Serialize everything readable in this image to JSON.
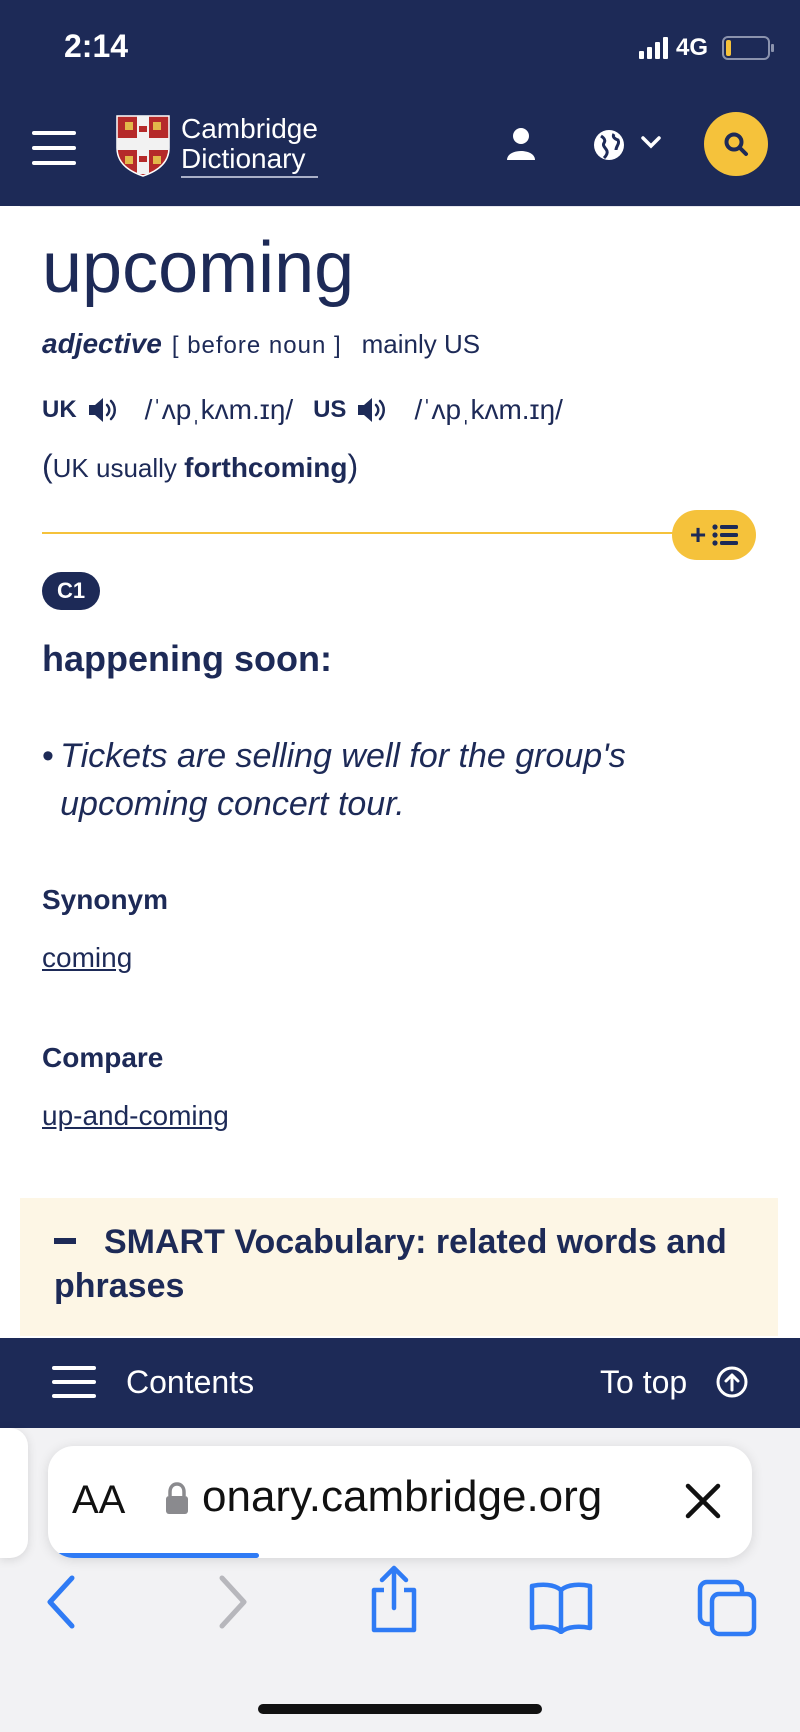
{
  "status_bar": {
    "time": "2:14",
    "network": "4G"
  },
  "header": {
    "logo_line1": "Cambridge",
    "logo_line2": "Dictionary"
  },
  "entry": {
    "headword": "upcoming",
    "pos": "adjective",
    "grammar": "[ before noun ]",
    "region": "mainly US",
    "uk_label": "UK",
    "uk_ipa": "/ˈʌpˌkʌm.ɪŋ/",
    "us_label": "US",
    "us_ipa": "/ˈʌpˌkʌm.ɪŋ/",
    "variant_open": "(",
    "variant_prefix": "UK usually",
    "variant_word": "forthcoming",
    "variant_close": ")",
    "cefr": "C1",
    "definition": "happening soon:",
    "example": "Tickets are selling well for the group's upcoming concert tour.",
    "synonym_heading": "Synonym",
    "synonym": "coming",
    "compare_heading": "Compare",
    "compare": "up-and-coming",
    "smart_vocab": "SMART Vocabulary: related words and phrases"
  },
  "bottom_nav": {
    "contents": "Contents",
    "to_top": "To top"
  },
  "browser": {
    "aa": "AA",
    "url": "onary.cambridge.org",
    "load_progress": 0.3
  },
  "colors": {
    "navy": "#1d2a57",
    "yellow": "#f5c23b",
    "cream": "#fdf6e5",
    "link_blue": "#2f7bf5"
  }
}
